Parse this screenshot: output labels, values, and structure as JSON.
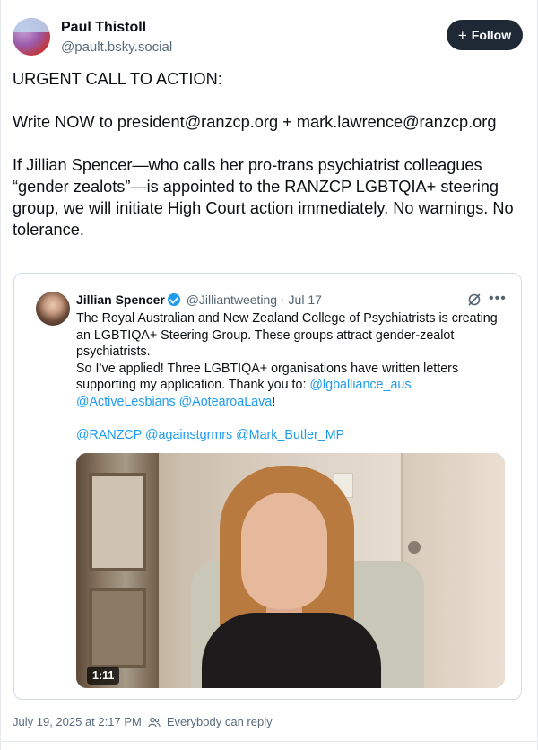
{
  "author": {
    "name": "Paul Thistoll",
    "handle": "@pault.bsky.social"
  },
  "follow_button": {
    "icon": "plus-icon",
    "label": "Follow"
  },
  "post": {
    "paragraphs": [
      "URGENT CALL TO ACTION:",
      "Write NOW to president@ranzcp.org + mark.lawrence@ranzcp.org",
      "If Jillian Spencer—who calls her pro-trans psychiatrist colleagues “gender zealots”—is appointed to the RANZCP LGBTQIA+ steering group, we will initiate High Court action immediately. No warnings. No tolerance."
    ],
    "timestamp": "July 19, 2025 at 2:17 PM",
    "reply_setting": "Everybody can reply"
  },
  "quoted": {
    "name": "Jillian Spencer",
    "handle": "@Jilliantweeting",
    "separator": "·",
    "date": "Jul 17",
    "more_icon": "more-icon",
    "line1": "The Royal Australian and New Zealand College of Psychiatrists is creating an LGBTIQA+ Steering Group. These groups attract gender-zealot psychiatrists.",
    "line2_text": "So I’ve applied! Three LGBTIQA+ organisations have written letters supporting my application. Thank you to: ",
    "mention1": "@lgballiance_aus",
    "mention2": "@ActiveLesbians",
    "mention3": "@AotearoaLava",
    "line2_end": "!",
    "mention4": "@RANZCP",
    "mention5": "@againstgrmrs",
    "mention6": "@Mark_Butler_MP",
    "video_duration": "1:11"
  },
  "colors": {
    "link": "#1d9bf0",
    "follow_bg": "#1e2935",
    "muted": "#5b6b7c"
  }
}
